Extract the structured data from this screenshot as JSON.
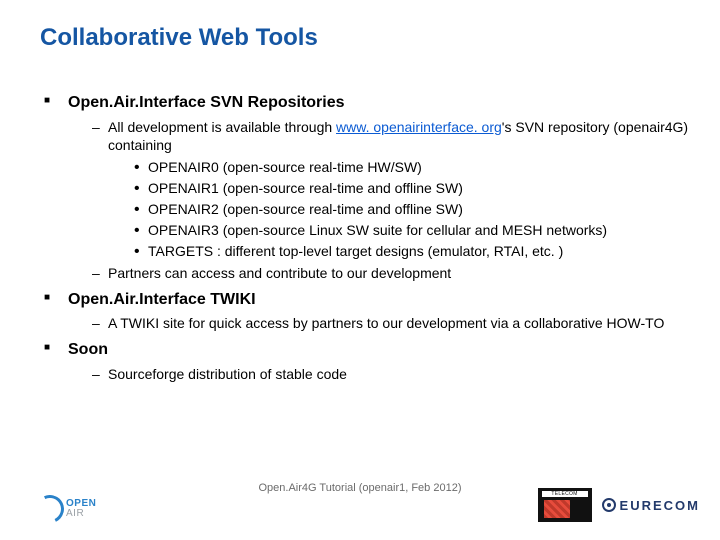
{
  "title": "Collaborative Web Tools",
  "sections": [
    {
      "heading": "Open.Air.Interface SVN Repositories",
      "items": [
        {
          "prefix": "All development is available through ",
          "link_text": "www. openairinterface. org",
          "link_href": "http://www.openairinterface.org",
          "suffix": "'s SVN repository (openair4G) containing",
          "sub": [
            "OPENAIR0 (open-source real-time HW/SW)",
            "OPENAIR1 (open-source real-time and offline SW)",
            "OPENAIR2 (open-source real-time and offline SW)",
            "OPENAIR3 (open-source Linux SW suite for cellular and MESH networks)",
            "TARGETS : different top-level target designs (emulator, RTAI, etc. )"
          ]
        },
        {
          "text": "Partners can access and contribute to our development"
        }
      ]
    },
    {
      "heading": "Open.Air.Interface TWIKI",
      "items": [
        {
          "text": "A TWIKI site for quick access by partners to our development via a collaborative HOW-TO"
        }
      ]
    },
    {
      "heading": "Soon",
      "items": [
        {
          "text": "Sourceforge distribution of stable code"
        }
      ]
    }
  ],
  "footer": {
    "text": "Open.Air4G Tutorial (openair1, Feb 2012)",
    "logo_left_main": "OPEN",
    "logo_left_sub": "AIR",
    "telecom_label": "TELECOM",
    "eurecom_label": "EURECOM"
  }
}
